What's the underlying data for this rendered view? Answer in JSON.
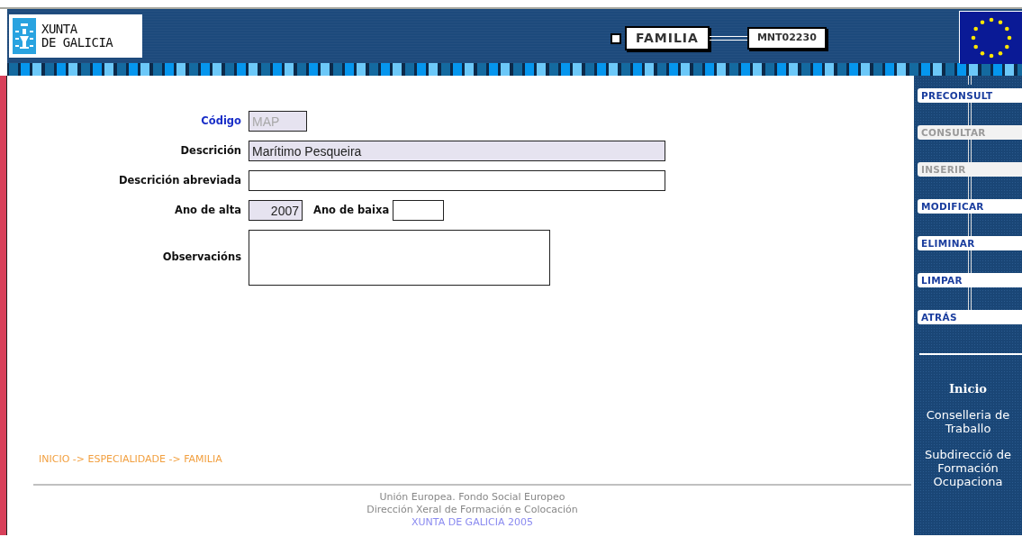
{
  "header": {
    "logo_lines": [
      "XUNTA",
      "DE GALICIA"
    ],
    "title": "FAMILIA",
    "code": "MNT02230"
  },
  "form": {
    "rows": [
      {
        "fields": [
          {
            "label": "Código",
            "label_highlighted": true,
            "kind": "code",
            "value": "MAP",
            "disabled": true
          }
        ]
      },
      {
        "fields": [
          {
            "label": "Descrición",
            "label_highlighted": false,
            "kind": "text",
            "value": "Marítimo Pesqueira",
            "disabled": false,
            "readonly": true
          }
        ]
      },
      {
        "fields": [
          {
            "label": "Descrición abreviada",
            "label_highlighted": false,
            "kind": "text",
            "disabled": false,
            "readonly": false
          }
        ]
      },
      {
        "fields": [
          {
            "label": "Ano de alta",
            "label_highlighted": false,
            "kind": "year",
            "value": "2007",
            "disabled": false,
            "readonly": true
          },
          {
            "label": "Ano de baixa",
            "label_highlighted": false,
            "kind": "year-inline",
            "disabled": false,
            "readonly": false
          }
        ]
      },
      {
        "fields": [
          {
            "label": "Observacións",
            "label_highlighted": false,
            "kind": "memo",
            "disabled": false,
            "readonly": false
          }
        ]
      }
    ]
  },
  "breadcrumb": "INICIO -> ESPECIALIDADE -> FAMILIA",
  "footer": [
    {
      "text": "Unión Europea. Fondo Social Europeo",
      "kind": "credit"
    },
    {
      "text": "Dirección Xeral de Formación e Colocación",
      "kind": "credit"
    },
    {
      "text": "XUNTA DE GALICIA 2005",
      "kind": "brand"
    }
  ],
  "sidebar": {
    "actions": [
      {
        "label": "PRECONSULT",
        "disabled": false
      },
      {
        "label": "CONSULTAR",
        "disabled": true
      },
      {
        "label": "INSERIR",
        "disabled": true
      },
      {
        "label": "MODIFICAR",
        "disabled": false
      },
      {
        "label": "ELIMINAR",
        "disabled": false
      },
      {
        "label": "LIMPAR",
        "disabled": false
      },
      {
        "label": "ATRÁS",
        "disabled": false
      }
    ],
    "links": [
      {
        "text": "Inicio",
        "kind": "home"
      },
      {
        "text": "Conselleria de Traballo",
        "kind": "org"
      },
      {
        "text": "Subdirecció de Formación Ocupaciona",
        "kind": "org"
      }
    ]
  }
}
